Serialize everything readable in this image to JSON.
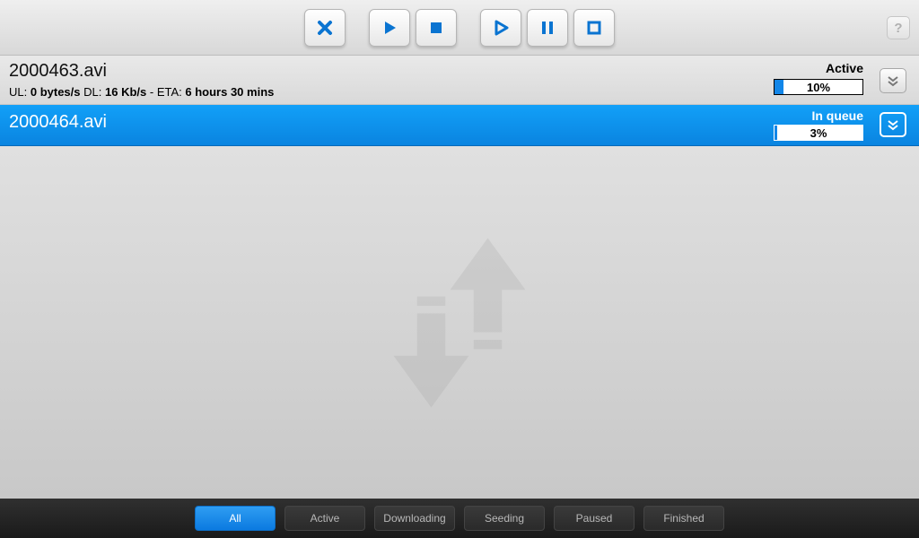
{
  "toolbar": {
    "buttons": [
      "remove",
      "start",
      "stop",
      "start-all",
      "pause-all",
      "stop-all"
    ]
  },
  "torrents": [
    {
      "filename": "2000463.avi",
      "status": "Active",
      "progress_pct": "10%",
      "progress_val": 10,
      "ul_label": "UL:",
      "ul_value": "0 bytes/s",
      "dl_label": "DL:",
      "dl_value": "16 Kb/s",
      "eta_label": "ETA:",
      "eta_value": "6 hours 30 mins",
      "selected": false,
      "expanded": true
    },
    {
      "filename": "2000464.avi",
      "status": "In queue",
      "progress_pct": "3%",
      "progress_val": 3,
      "selected": true,
      "expanded": false
    }
  ],
  "filters": [
    {
      "label": "All",
      "active": true
    },
    {
      "label": "Active",
      "active": false
    },
    {
      "label": "Downloading",
      "active": false
    },
    {
      "label": "Seeding",
      "active": false
    },
    {
      "label": "Paused",
      "active": false
    },
    {
      "label": "Finished",
      "active": false
    }
  ],
  "help_label": "?"
}
